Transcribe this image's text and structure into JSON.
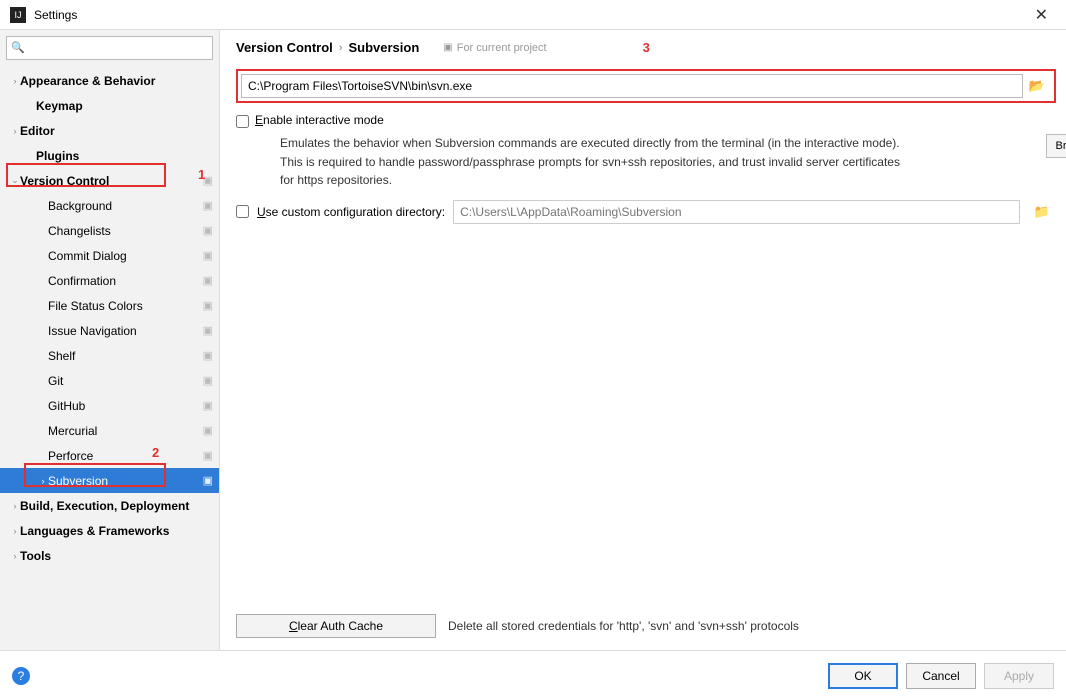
{
  "window": {
    "title": "Settings"
  },
  "sidebar": {
    "search_placeholder": "",
    "items": [
      {
        "label": "Appearance & Behavior",
        "level": 0,
        "bold": true,
        "arrow": "›"
      },
      {
        "label": "Keymap",
        "level": 1,
        "bold": true
      },
      {
        "label": "Editor",
        "level": 0,
        "bold": true,
        "arrow": "›"
      },
      {
        "label": "Plugins",
        "level": 1,
        "bold": true
      },
      {
        "label": "Version Control",
        "level": 0,
        "bold": true,
        "arrow": "⌄",
        "cfg": true,
        "redbox": true
      },
      {
        "label": "Background",
        "level": 2,
        "cfg": true
      },
      {
        "label": "Changelists",
        "level": 2,
        "cfg": true
      },
      {
        "label": "Commit Dialog",
        "level": 2,
        "cfg": true
      },
      {
        "label": "Confirmation",
        "level": 2,
        "cfg": true
      },
      {
        "label": "File Status Colors",
        "level": 2,
        "cfg": true
      },
      {
        "label": "Issue Navigation",
        "level": 2,
        "cfg": true
      },
      {
        "label": "Shelf",
        "level": 2,
        "cfg": true
      },
      {
        "label": "Git",
        "level": 2,
        "cfg": true
      },
      {
        "label": "GitHub",
        "level": 2,
        "cfg": true
      },
      {
        "label": "Mercurial",
        "level": 2,
        "cfg": true
      },
      {
        "label": "Perforce",
        "level": 2,
        "cfg": true
      },
      {
        "label": "Subversion",
        "level": 2,
        "cfg": true,
        "arrow": "›",
        "selected": true,
        "redbox2": true
      },
      {
        "label": "Build, Execution, Deployment",
        "level": 0,
        "bold": true,
        "arrow": "›"
      },
      {
        "label": "Languages & Frameworks",
        "level": 0,
        "bold": true,
        "arrow": "›"
      },
      {
        "label": "Tools",
        "level": 0,
        "bold": true,
        "arrow": "›"
      }
    ]
  },
  "breadcrumb": {
    "parent": "Version Control",
    "current": "Subversion",
    "scope": "For current project"
  },
  "annotations": {
    "one": "1",
    "two": "2",
    "three": "3"
  },
  "main": {
    "path_value": "C:\\Program Files\\TortoiseSVN\\bin\\svn.exe",
    "interactive_label": "Enable interactive mode",
    "interactive_u": "E",
    "interactive_desc1": "Emulates the behavior when Subversion commands are executed directly from the terminal (in the interactive mode).",
    "interactive_desc2": "This is required to handle password/passphrase prompts for svn+ssh repositories, and trust invalid server certificates for https repositories.",
    "custom_dir_label": "Use custom configuration directory:",
    "custom_dir_u": "U",
    "custom_dir_placeholder": "C:\\Users\\L\\AppData\\Roaming\\Subversion",
    "browse_label": "Br",
    "clear_auth_label": "Clear Auth Cache",
    "clear_auth_u": "C",
    "clear_auth_desc": "Delete all stored credentials for 'http', 'svn' and 'svn+ssh' protocols"
  },
  "footer": {
    "ok": "OK",
    "cancel": "Cancel",
    "apply": "Apply"
  }
}
